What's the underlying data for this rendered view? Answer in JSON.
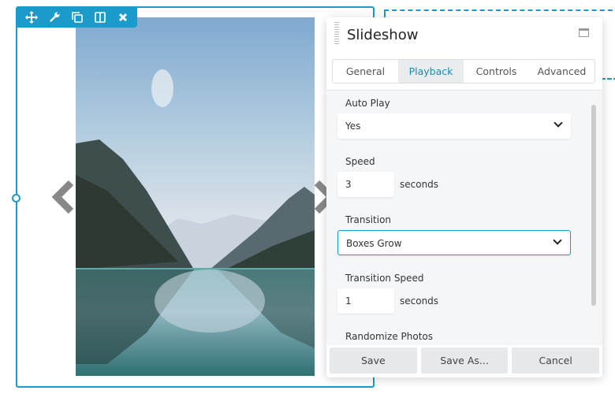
{
  "toolbar": {
    "icons": [
      "move-icon",
      "wrench-icon",
      "duplicate-icon",
      "columns-icon",
      "close-icon"
    ]
  },
  "panel": {
    "title": "Slideshow",
    "tabs": [
      {
        "label": "General"
      },
      {
        "label": "Playback",
        "active": true
      },
      {
        "label": "Controls"
      },
      {
        "label": "Advanced"
      }
    ],
    "fields": {
      "auto_play": {
        "label": "Auto Play",
        "value": "Yes"
      },
      "speed": {
        "label": "Speed",
        "value": "3",
        "unit": "seconds"
      },
      "transition": {
        "label": "Transition",
        "value": "Boxes Grow"
      },
      "transition_speed": {
        "label": "Transition Speed",
        "value": "1",
        "unit": "seconds"
      },
      "randomize": {
        "label": "Randomize Photos"
      }
    },
    "buttons": {
      "save": "Save",
      "save_as": "Save As...",
      "cancel": "Cancel"
    }
  },
  "colors": {
    "accent": "#1a9bcc",
    "active_tab": "#1f8aa8"
  }
}
